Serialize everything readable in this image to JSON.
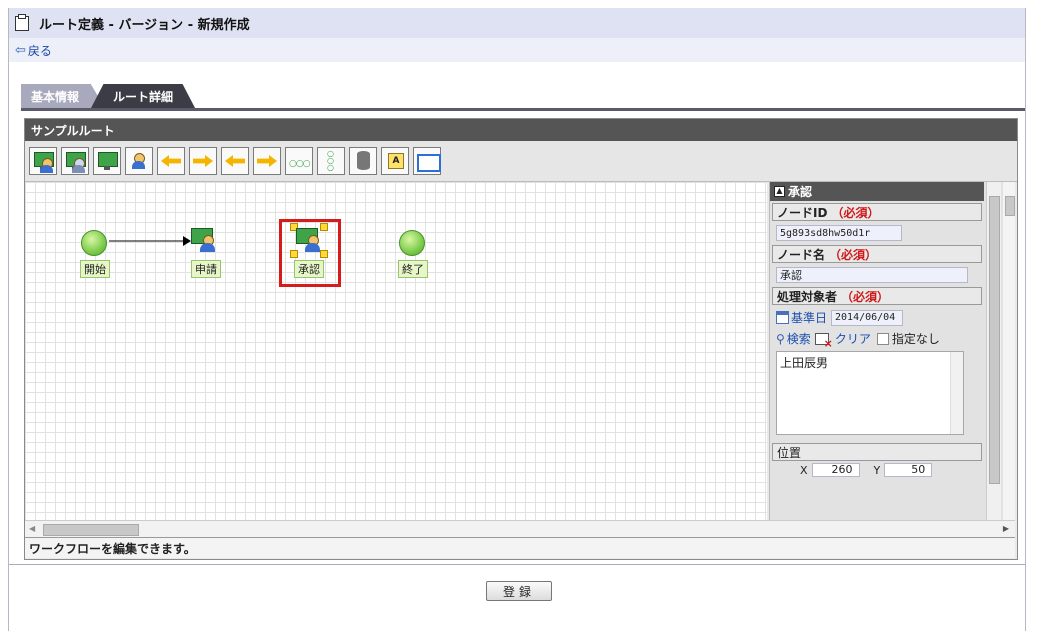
{
  "header": {
    "title": "ルート定義 - バージョン - 新規作成",
    "back_label": "戻る",
    "title_icon": "clipboard-icon",
    "back_icon": "back-arrow-icon"
  },
  "tabs": [
    {
      "label": "基本情報",
      "active": false
    },
    {
      "label": "ルート詳細",
      "active": true
    }
  ],
  "panel": {
    "title": "サンプルルート",
    "status_text": "ワークフローを編集できます。"
  },
  "toolbar": {
    "tools": [
      "user-node-icon",
      "role-node-icon",
      "system-node-icon",
      "person-icon",
      "branch-icon",
      "merge-icon",
      "branch-back-icon",
      "merge-back-icon",
      "connector-icon",
      "vertical-node-icon",
      "database-icon",
      "text-icon",
      "frame-icon"
    ]
  },
  "canvas": {
    "nodes": [
      {
        "label": "開始",
        "type": "start"
      },
      {
        "label": "申請",
        "type": "user"
      },
      {
        "label": "承認",
        "type": "user",
        "selected": true
      },
      {
        "label": "終了",
        "type": "end"
      }
    ]
  },
  "properties": {
    "section_title": "承認",
    "node_id_label": "ノードID",
    "node_id_req": "（必須）",
    "node_id_value": "5g893sd8hw50d1r",
    "node_name_label": "ノード名",
    "node_name_req": "（必須）",
    "node_name_value": "承認",
    "target_label": "処理対象者",
    "target_req": "（必須）",
    "base_date_label": "基準日",
    "base_date_value": "2014/06/04",
    "search_label": "検索",
    "clear_label": "クリア",
    "no_spec_label": "指定なし",
    "assignee_value": "上田辰男",
    "position_label": "位置",
    "x_label": "X",
    "x_value": "260",
    "y_label": "Y",
    "y_value": "50"
  },
  "actions": {
    "save_label": "登録"
  },
  "colors": {
    "accent": "#d61b1b",
    "header_bg": "#dfe2f2",
    "panel_title_bg": "#555555"
  }
}
